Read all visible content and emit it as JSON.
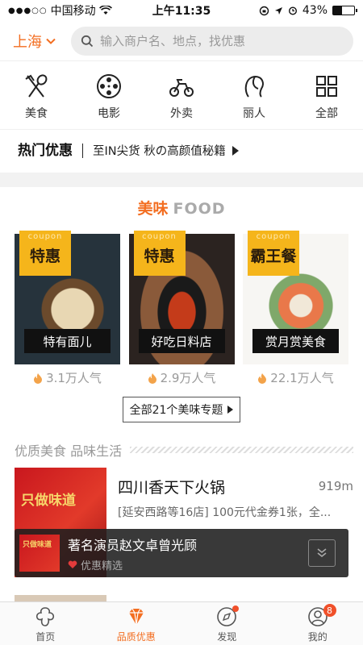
{
  "status_bar": {
    "carrier": "中国移动",
    "time": "上午11:35",
    "battery": "43%",
    "battery_level": 0.43
  },
  "header": {
    "city": "上海",
    "search_placeholder": "输入商户名、地点，找优惠"
  },
  "categories": [
    {
      "label": "美食",
      "icon": "food-icon"
    },
    {
      "label": "电影",
      "icon": "film-reel-icon"
    },
    {
      "label": "外卖",
      "icon": "scooter-icon"
    },
    {
      "label": "丽人",
      "icon": "beauty-icon"
    },
    {
      "label": "全部",
      "icon": "grid-icon"
    }
  ],
  "hot_promo": {
    "title": "热门优惠",
    "text": "至IN尖货 秋の高颜值秘籍"
  },
  "food_section": {
    "title_cn": "美味",
    "title_en": "FOOD",
    "cards": [
      {
        "coupon_tag": "coupon",
        "coupon_name": "特惠",
        "caption": "特有面儿",
        "popularity": "3.1万人气"
      },
      {
        "coupon_tag": "coupon",
        "coupon_name": "特惠",
        "caption": "好吃日料店",
        "popularity": "2.9万人气"
      },
      {
        "coupon_tag": "coupon",
        "coupon_name": "霸王餐",
        "caption": "赏月赏美食",
        "popularity": "22.1万人气"
      }
    ],
    "all_topics": "全部21个美味专题"
  },
  "quality": {
    "title": "优质美食 品味生活"
  },
  "restaurant": {
    "name": "四川香天下火锅",
    "distance": "919m",
    "desc": "[延安西路等16店] 100元代金券1张，全...",
    "image_text": "只做味道"
  },
  "toast": {
    "title": "著名演员赵文卓曾光顾",
    "sub": "优惠精选",
    "thumb_text": "只做味道"
  },
  "tabbar": {
    "tabs": [
      {
        "label": "首页"
      },
      {
        "label": "品质优惠"
      },
      {
        "label": "发现"
      },
      {
        "label": "我的",
        "badge": "8"
      }
    ]
  },
  "colors": {
    "accent": "#f36e21",
    "coupon": "#f5b51b",
    "badge": "#f0502a"
  }
}
